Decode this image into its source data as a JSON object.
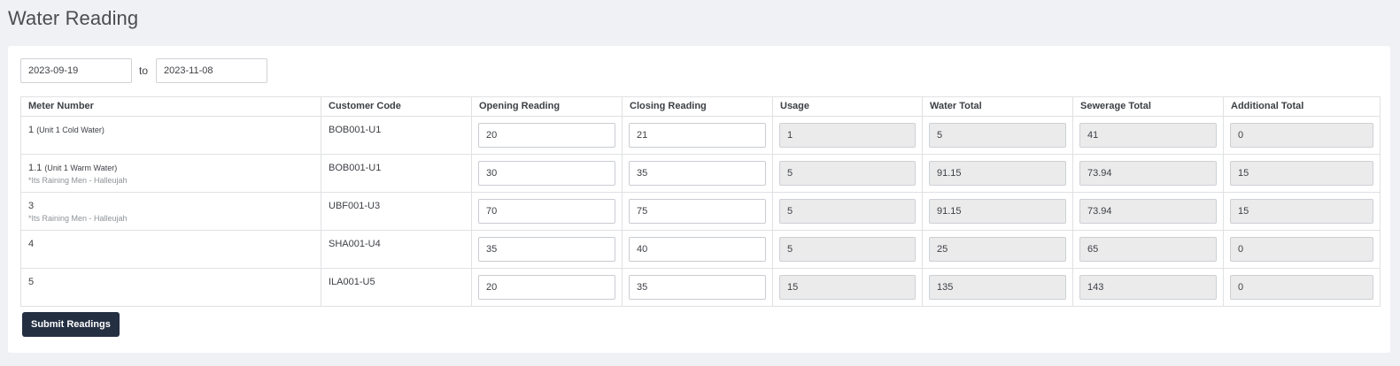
{
  "page": {
    "title": "Water Reading"
  },
  "filters": {
    "date_from": "2023-09-19",
    "separator": "to",
    "date_to": "2023-11-08"
  },
  "table": {
    "headers": [
      "Meter Number",
      "Customer Code",
      "Opening Reading",
      "Closing Reading",
      "Usage",
      "Water Total",
      "Sewerage Total",
      "Additional Total"
    ],
    "rows": [
      {
        "meter_number": "1",
        "meter_desc": "(Unit 1 Cold Water)",
        "meter_note": "",
        "customer_code": "BOB001-U1",
        "opening": "20",
        "closing": "21",
        "usage": "1",
        "water_total": "5",
        "sewerage_total": "41",
        "additional_total": "0"
      },
      {
        "meter_number": "1.1",
        "meter_desc": "(Unit 1 Warm Water)",
        "meter_note": "*Its Raining Men - Halleujah",
        "customer_code": "BOB001-U1",
        "opening": "30",
        "closing": "35",
        "usage": "5",
        "water_total": "91.15",
        "sewerage_total": "73.94",
        "additional_total": "15"
      },
      {
        "meter_number": "3",
        "meter_desc": "",
        "meter_note": "*Its Raining Men - Halleujah",
        "customer_code": "UBF001-U3",
        "opening": "70",
        "closing": "75",
        "usage": "5",
        "water_total": "91.15",
        "sewerage_total": "73.94",
        "additional_total": "15"
      },
      {
        "meter_number": "4",
        "meter_desc": "",
        "meter_note": "",
        "customer_code": "SHA001-U4",
        "opening": "35",
        "closing": "40",
        "usage": "5",
        "water_total": "25",
        "sewerage_total": "65",
        "additional_total": "0"
      },
      {
        "meter_number": "5",
        "meter_desc": "",
        "meter_note": "",
        "customer_code": "ILA001-U5",
        "opening": "20",
        "closing": "35",
        "usage": "15",
        "water_total": "135",
        "sewerage_total": "143",
        "additional_total": "0"
      }
    ]
  },
  "actions": {
    "submit_label": "Submit Readings"
  }
}
